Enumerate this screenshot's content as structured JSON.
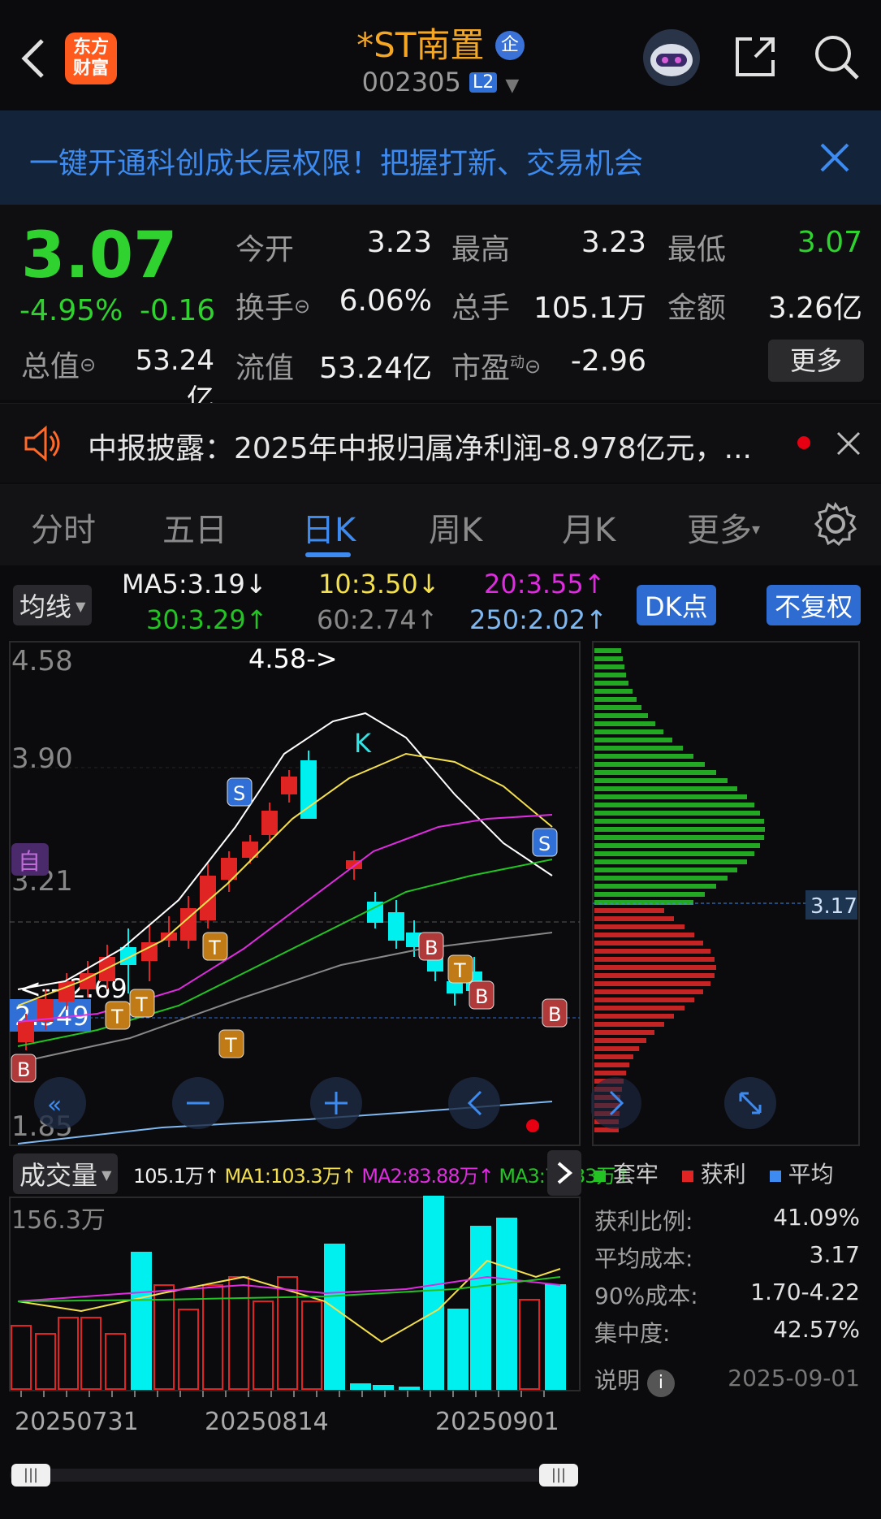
{
  "header": {
    "title": "*ST南置",
    "enterprise_badge": "企",
    "code": "002305",
    "level": "L2",
    "logo_line1": "东方",
    "logo_line2": "财富",
    "icons": [
      "back-arrow-icon",
      "robot-avatar-icon",
      "share-icon",
      "search-icon"
    ]
  },
  "banner": {
    "text": "一键开通科创成长层权限！把握打新、交易机会"
  },
  "quote": {
    "price": "3.07",
    "change_pct": "-4.95%",
    "change": "-0.16",
    "open_label": "今开",
    "open": "3.23",
    "high_label": "最高",
    "high": "3.23",
    "low_label": "最低",
    "low": "3.07",
    "turnover_label": "换手",
    "turnover": "6.06%",
    "volume_label": "总手",
    "volume": "105.1万",
    "amount_label": "金额",
    "amount": "3.26亿",
    "total_value_label": "总值",
    "total_value": "53.24亿",
    "float_value_label": "流值",
    "float_value": "53.24亿",
    "pe_label": "市盈",
    "pe_sup": "动",
    "pe": "-2.96",
    "more": "更多"
  },
  "notice": {
    "text": "中报披露：2025年中报归属净利润-8.978亿元，..."
  },
  "tabs": [
    "分时",
    "五日",
    "日K",
    "周K",
    "月K",
    "更多"
  ],
  "active_tab": 2,
  "indicators": {
    "ma_selector": "均线",
    "ma5": "MA5:3.19↓",
    "ma10": "10:3.50↓",
    "ma20": "20:3.55↑",
    "ma30": "30:3.29↑",
    "ma60": "60:2.74↑",
    "ma250": "250:2.02↑",
    "dk_button": "DK点",
    "adjust_button": "不复权"
  },
  "kline": {
    "y_labels": [
      "4.58",
      "3.90",
      "3.21",
      "2.549",
      "1.85"
    ],
    "max_label": "4.58->",
    "min_label": "<---2.69",
    "auto_tag": "自",
    "k_marker": "K",
    "cost_tag": "3.17"
  },
  "volume": {
    "selector": "成交量",
    "vol": "105.1万↑",
    "ma1": "MA1:103.3万↑",
    "ma2": "MA2:83.88万↑",
    "ma3": "MA3:78.33万↑",
    "top_label": "156.3万",
    "dates": [
      "20250731",
      "20250814",
      "20250901"
    ]
  },
  "chips": {
    "legend": [
      "套牢",
      "获利",
      "平均"
    ],
    "profit_ratio_label": "获利比例:",
    "profit_ratio": "41.09%",
    "avg_cost_label": "平均成本:",
    "avg_cost": "3.17",
    "cost90_label": "90%成本:",
    "cost90": "1.70-4.22",
    "concentration_label": "集中度:",
    "concentration": "42.57%",
    "note_label": "说明",
    "date": "2025-09-01"
  },
  "colors": {
    "up": "#e02424",
    "down": "#00f0f0",
    "green": "#2fd22f",
    "accent": "#3d8bf0",
    "orange": "#f5a623"
  }
}
